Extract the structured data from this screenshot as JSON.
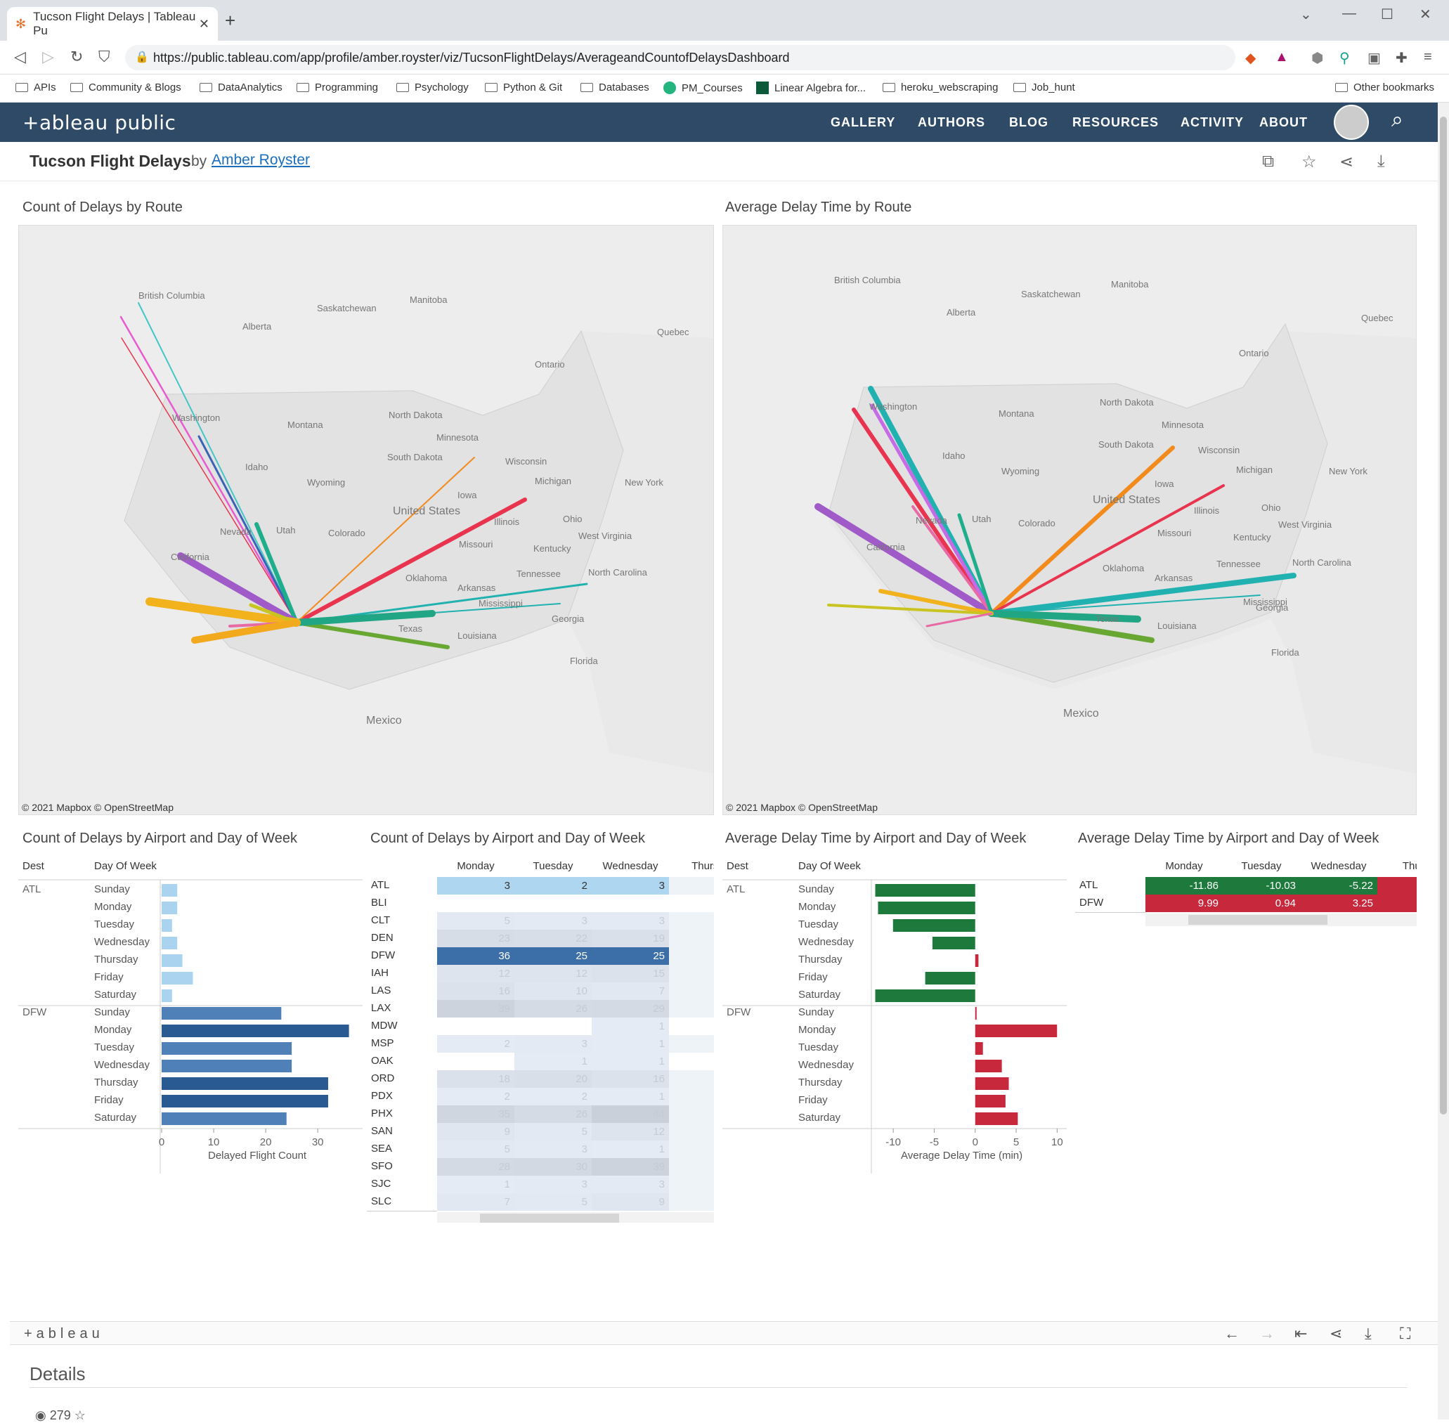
{
  "browser": {
    "tab_title": "Tucson Flight Delays | Tableau Pu",
    "url": "https://public.tableau.com/app/profile/amber.royster/viz/TucsonFlightDelays/AverageandCountofDelaysDashboard",
    "bookmarks": [
      "APIs",
      "Community & Blogs",
      "DataAnalytics",
      "Programming",
      "Psychology",
      "Python & Git",
      "Databases",
      "PM_Courses",
      "Linear Algebra for...",
      "heroku_webscraping",
      "Job_hunt"
    ],
    "other_bookmarks": "Other bookmarks"
  },
  "site": {
    "logo": "+ableau public",
    "nav": [
      "GALLERY",
      "AUTHORS",
      "BLOG",
      "RESOURCES",
      "ACTIVITY",
      "ABOUT"
    ]
  },
  "viz": {
    "title": "Tucson Flight Delays",
    "by": "by",
    "author": "Amber Royster"
  },
  "maps": {
    "left_title": "Count of Delays by Route",
    "right_title": "Average Delay Time by Route",
    "attribution": "© 2021 Mapbox  © OpenStreetMap",
    "labels": [
      "British Columbia",
      "Alberta",
      "Saskatchewan",
      "Manitoba",
      "Ontario",
      "Quebec",
      "Washington",
      "Montana",
      "North Dakota",
      "Minnesota",
      "South Dakota",
      "Wyoming",
      "Idaho",
      "Wisconsin",
      "Michigan",
      "New York",
      "Iowa",
      "United States",
      "Illinois",
      "Ohio",
      "Colorado",
      "Utah",
      "Nevada",
      "California",
      "Missouri",
      "Kentucky",
      "West Virginia",
      "Oklahoma",
      "Arkansas",
      "Tennessee",
      "North Carolina",
      "Mississippi",
      "Georgia",
      "Texas",
      "Louisiana",
      "Florida",
      "Mexico"
    ]
  },
  "panels": {
    "p1_title": "Count of Delays by Airport and Day of Week",
    "p2_title": "Count of Delays by Airport and Day of Week",
    "p3_title": "Average Delay Time by Airport and Day of Week",
    "p4_title": "Average Delay Time by Airport and Day of Week",
    "dest_hdr": "Dest",
    "dow_hdr": "Day Of Week",
    "x1_label": "Delayed Flight Count",
    "x3_label": "Average Delay Time (min)"
  },
  "chart_data": [
    {
      "type": "bar",
      "title": "Count of Delays by Airport and Day of Week",
      "xlabel": "Delayed Flight Count",
      "xlim": [
        0,
        37
      ],
      "xticks": [
        0,
        10,
        20,
        30
      ],
      "groups": [
        {
          "dest": "ATL",
          "days": [
            "Sunday",
            "Monday",
            "Tuesday",
            "Wednesday",
            "Thursday",
            "Friday",
            "Saturday"
          ],
          "values": [
            3,
            3,
            2,
            3,
            4,
            6,
            2
          ]
        },
        {
          "dest": "DFW",
          "days": [
            "Sunday",
            "Monday",
            "Tuesday",
            "Wednesday",
            "Thursday",
            "Friday",
            "Saturday"
          ],
          "values": [
            23,
            36,
            25,
            25,
            32,
            32,
            24
          ]
        }
      ]
    },
    {
      "type": "table",
      "title": "Count of Delays by Airport and Day of Week",
      "columns": [
        "Monday",
        "Tuesday",
        "Wednesday",
        "Thursc"
      ],
      "rows": [
        {
          "dest": "ATL",
          "values": [
            "3",
            "2",
            "3",
            ""
          ]
        },
        {
          "dest": "BLI",
          "values": [
            "",
            "",
            "",
            ""
          ]
        },
        {
          "dest": "CLT",
          "values": [
            "5",
            "3",
            "3",
            ""
          ]
        },
        {
          "dest": "DEN",
          "values": [
            "23",
            "22",
            "19",
            ""
          ]
        },
        {
          "dest": "DFW",
          "values": [
            "36",
            "25",
            "25",
            ""
          ]
        },
        {
          "dest": "IAH",
          "values": [
            "12",
            "12",
            "15",
            ""
          ]
        },
        {
          "dest": "LAS",
          "values": [
            "16",
            "10",
            "7",
            ""
          ]
        },
        {
          "dest": "LAX",
          "values": [
            "39",
            "26",
            "29",
            ""
          ]
        },
        {
          "dest": "MDW",
          "values": [
            "",
            "",
            "1",
            ""
          ]
        },
        {
          "dest": "MSP",
          "values": [
            "2",
            "3",
            "1",
            ""
          ]
        },
        {
          "dest": "OAK",
          "values": [
            "",
            "1",
            "1",
            ""
          ]
        },
        {
          "dest": "ORD",
          "values": [
            "18",
            "20",
            "16",
            ""
          ]
        },
        {
          "dest": "PDX",
          "values": [
            "2",
            "2",
            "1",
            ""
          ]
        },
        {
          "dest": "PHX",
          "values": [
            "35",
            "26",
            "44",
            ""
          ]
        },
        {
          "dest": "SAN",
          "values": [
            "9",
            "5",
            "12",
            ""
          ]
        },
        {
          "dest": "SEA",
          "values": [
            "5",
            "3",
            "1",
            ""
          ]
        },
        {
          "dest": "SFO",
          "values": [
            "28",
            "30",
            "39",
            ""
          ]
        },
        {
          "dest": "SJC",
          "values": [
            "1",
            "3",
            "3",
            ""
          ]
        },
        {
          "dest": "SLC",
          "values": [
            "7",
            "5",
            "9",
            ""
          ]
        }
      ]
    },
    {
      "type": "bar",
      "title": "Average Delay Time by Airport and Day of Week",
      "xlabel": "Average Delay Time (min)",
      "xlim": [
        -12.5,
        11
      ],
      "xticks": [
        -10,
        -5,
        0,
        5,
        10
      ],
      "groups": [
        {
          "dest": "ATL",
          "days": [
            "Sunday",
            "Monday",
            "Tuesday",
            "Wednesday",
            "Thursday",
            "Friday",
            "Saturday"
          ],
          "values": [
            -12.2,
            -11.86,
            -10.03,
            -5.22,
            0.4,
            -6.1,
            -12.2
          ]
        },
        {
          "dest": "DFW",
          "days": [
            "Sunday",
            "Monday",
            "Tuesday",
            "Wednesday",
            "Thursday",
            "Friday",
            "Saturday"
          ],
          "values": [
            0.1,
            9.99,
            0.94,
            3.25,
            4.1,
            3.7,
            5.2
          ]
        }
      ]
    },
    {
      "type": "table",
      "title": "Average Delay Time by Airport and Day of Week",
      "columns": [
        "Monday",
        "Tuesday",
        "Wednesday",
        "Thurs"
      ],
      "rows": [
        {
          "dest": "ATL",
          "values": [
            "-11.86",
            "-10.03",
            "-5.22",
            ""
          ]
        },
        {
          "dest": "DFW",
          "values": [
            "9.99",
            "0.94",
            "3.25",
            ""
          ]
        }
      ]
    }
  ],
  "colors": {
    "header": "#2e4a66",
    "negative": "#1e7a3c",
    "positive": "#c8283c",
    "bar_light": "#a9d3ee",
    "bar_dark": "#2a5a92"
  },
  "footer": {
    "logo": "+ableau",
    "details": "Details",
    "views": "279"
  }
}
